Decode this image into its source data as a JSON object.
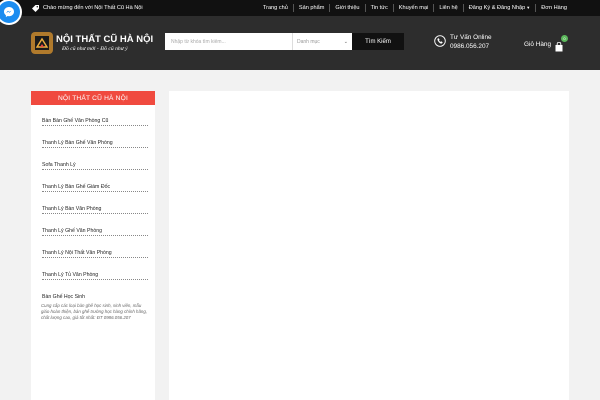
{
  "topbar": {
    "welcome": "Chào mừng đến với Nội Thất Cũ Hà Nội",
    "nav": [
      "Trang chủ",
      "Sản phẩm",
      "Giới thiệu",
      "Tin tức",
      "Khuyến mại",
      "Liên hệ",
      "Đăng Ký & Đăng Nhập",
      "Đơn Hàng"
    ]
  },
  "header": {
    "logo_title": "NỘI THẤT CŨ HÀ NỘI",
    "logo_slogan": "Đồ cũ như mới - Đồ cũ như ý",
    "search_placeholder": "Nhập từ khóa tìm kiếm...",
    "category_placeholder": "Danh mục",
    "search_button": "Tìm Kiếm",
    "phone_label": "Tư Vấn Online",
    "phone_number": "0986.056.207",
    "cart_label": "Giỏ Hàng",
    "cart_count": "0"
  },
  "sidebar": {
    "title": "NỘI THẤT CŨ HÀ NỘI",
    "items": [
      "Bàn Bàn Ghế Văn Phòng Cũ",
      "Thanh Lý Bàn Ghế Văn Phòng",
      "Sofa Thanh Lý",
      "Thanh Lý Bàn Ghế Giám Đốc",
      "Thanh Lý Bàn Văn Phòng",
      "Thanh Lý Ghế Văn Phòng",
      "Thanh Lý Nội Thất Văn Phòng",
      "Thanh Lý Tủ Văn Phòng",
      "Bàn Ghế Học Sinh"
    ],
    "last_item_description": "Cung cấp các loại bàn ghế học sinh, sinh viên, mẫu giáo hoàn thiện, bàn ghế trường học hàng chính hãng, chất lượng cao, giá tốt nhất: ĐT 0986.056.207"
  },
  "colors": {
    "topbar_bg": "#111111",
    "header_bg": "#2d2d2d",
    "accent_red": "#f04a3f",
    "messenger_blue": "#1a8cf0",
    "cart_badge_green": "#5cb85c"
  }
}
